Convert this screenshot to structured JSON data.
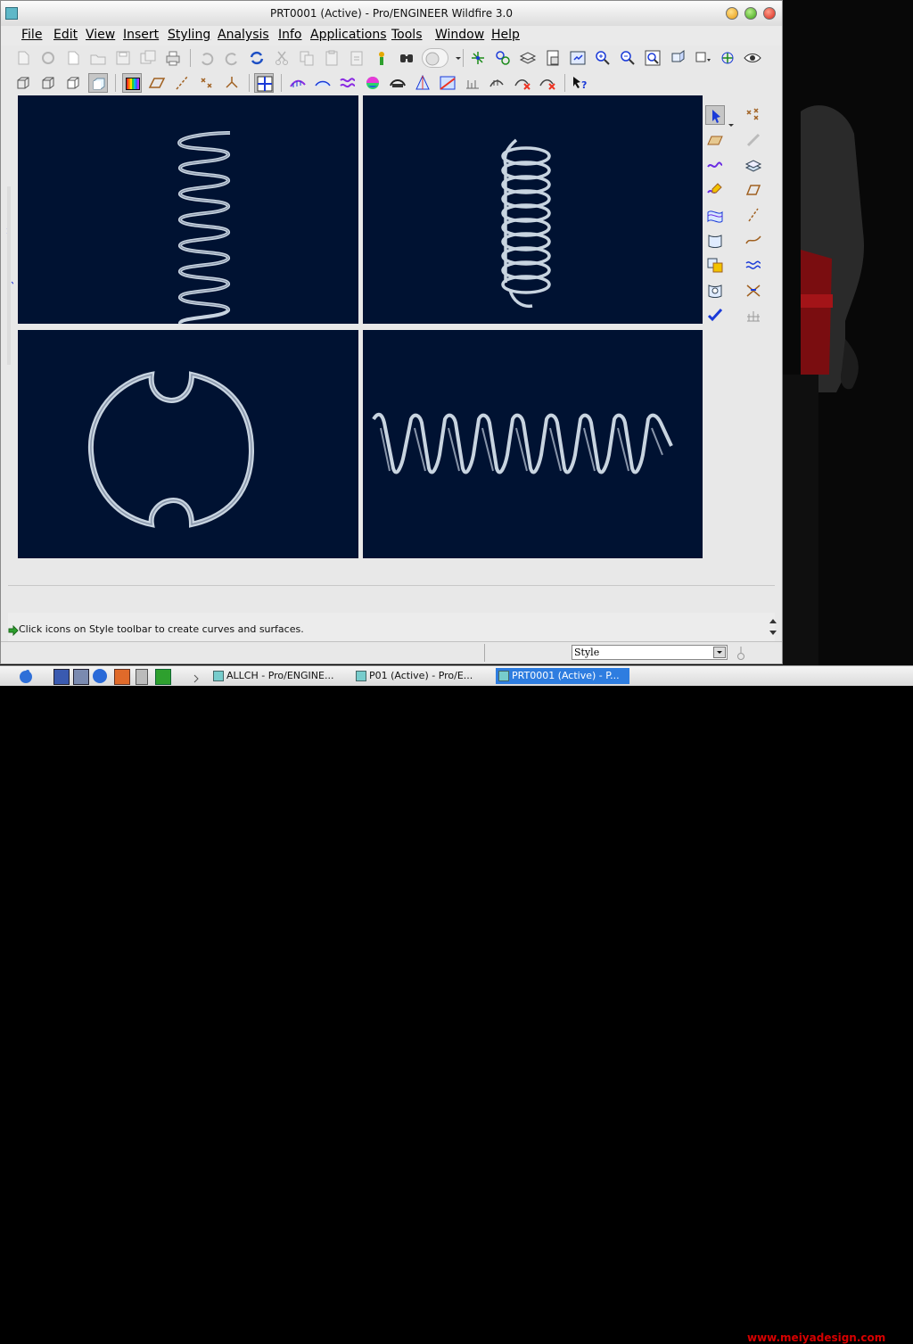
{
  "window": {
    "title": "PRT0001 (Active) - Pro/ENGINEER Wildfire 3.0"
  },
  "menu": [
    {
      "label": "File"
    },
    {
      "label": "Edit"
    },
    {
      "label": "View"
    },
    {
      "label": "Insert"
    },
    {
      "label": "Styling"
    },
    {
      "label": "Analysis"
    },
    {
      "label": "Info"
    },
    {
      "label": "Applications"
    },
    {
      "label": "Tools"
    },
    {
      "label": "Window"
    },
    {
      "label": "Help"
    }
  ],
  "toolbar_top": [
    "new-icon",
    "new-window-icon",
    "create-file-icon",
    "open-icon",
    "save-icon",
    "save-copy-icon",
    "print-icon",
    "undo-icon",
    "redo-icon",
    "regenerate-icon",
    "cut-icon",
    "copy-icon",
    "paste-icon",
    "paste-special-icon",
    "model-tree-icon",
    "find-icon",
    "selection-filter-icon",
    "datum-point-icon",
    "datum-axis-icon",
    "layers-icon",
    "view-manager-icon",
    "repaint-icon",
    "zoom-in-icon",
    "zoom-out-icon",
    "refit-icon",
    "reorient-icon",
    "saved-views-icon",
    "spin-center-icon",
    "visibility-icon"
  ],
  "toolbar_second": [
    "wireframe-icon",
    "hidden-line-icon",
    "no-hidden-icon",
    "shading-icon",
    "color-appearance-icon",
    "datum-plane-display-icon",
    "datum-axis-display-icon",
    "point-display-icon",
    "csys-display-icon",
    "grid-icon",
    "curvature-icon",
    "section-icon",
    "offset-icon",
    "reflection-icon",
    "shade-analysis-icon",
    "draft-icon",
    "slope-icon",
    "dihedral-icon",
    "delete-analysis-icon",
    "hide-analysis-icon",
    "context-help-icon"
  ],
  "right_toolbar": [
    "select-arrow-icon",
    "point-cross-icon",
    "sketch-plane-icon",
    "chain-icon",
    "curve-icon",
    "surface-stack-icon",
    "edit-curve-icon",
    "plane-icon",
    "boundary-surface-icon",
    "axis-line-icon",
    "surface-icon",
    "freeform-curve-icon",
    "connect-surface-icon",
    "offset-curve-icon",
    "trim-surface-icon",
    "intersect-curve-icon",
    "done-check-icon",
    "grid-points-icon"
  ],
  "status": {
    "message": "Click icons on Style toolbar to create curves and surfaces.",
    "filter_value": "Style"
  },
  "taskbar": {
    "tasks": [
      {
        "label": "ALLCH - Pro/ENGINE..."
      },
      {
        "label": "P01 (Active) - Pro/E..."
      },
      {
        "label": "PRT0001 (Active) - P..."
      }
    ],
    "watermark": "www.meiyadesign.com"
  },
  "colors": {
    "viewport_bg": "#001232",
    "spring": "#c8d4e0",
    "accent": "#2e7de0",
    "watermark": "#d60000"
  }
}
